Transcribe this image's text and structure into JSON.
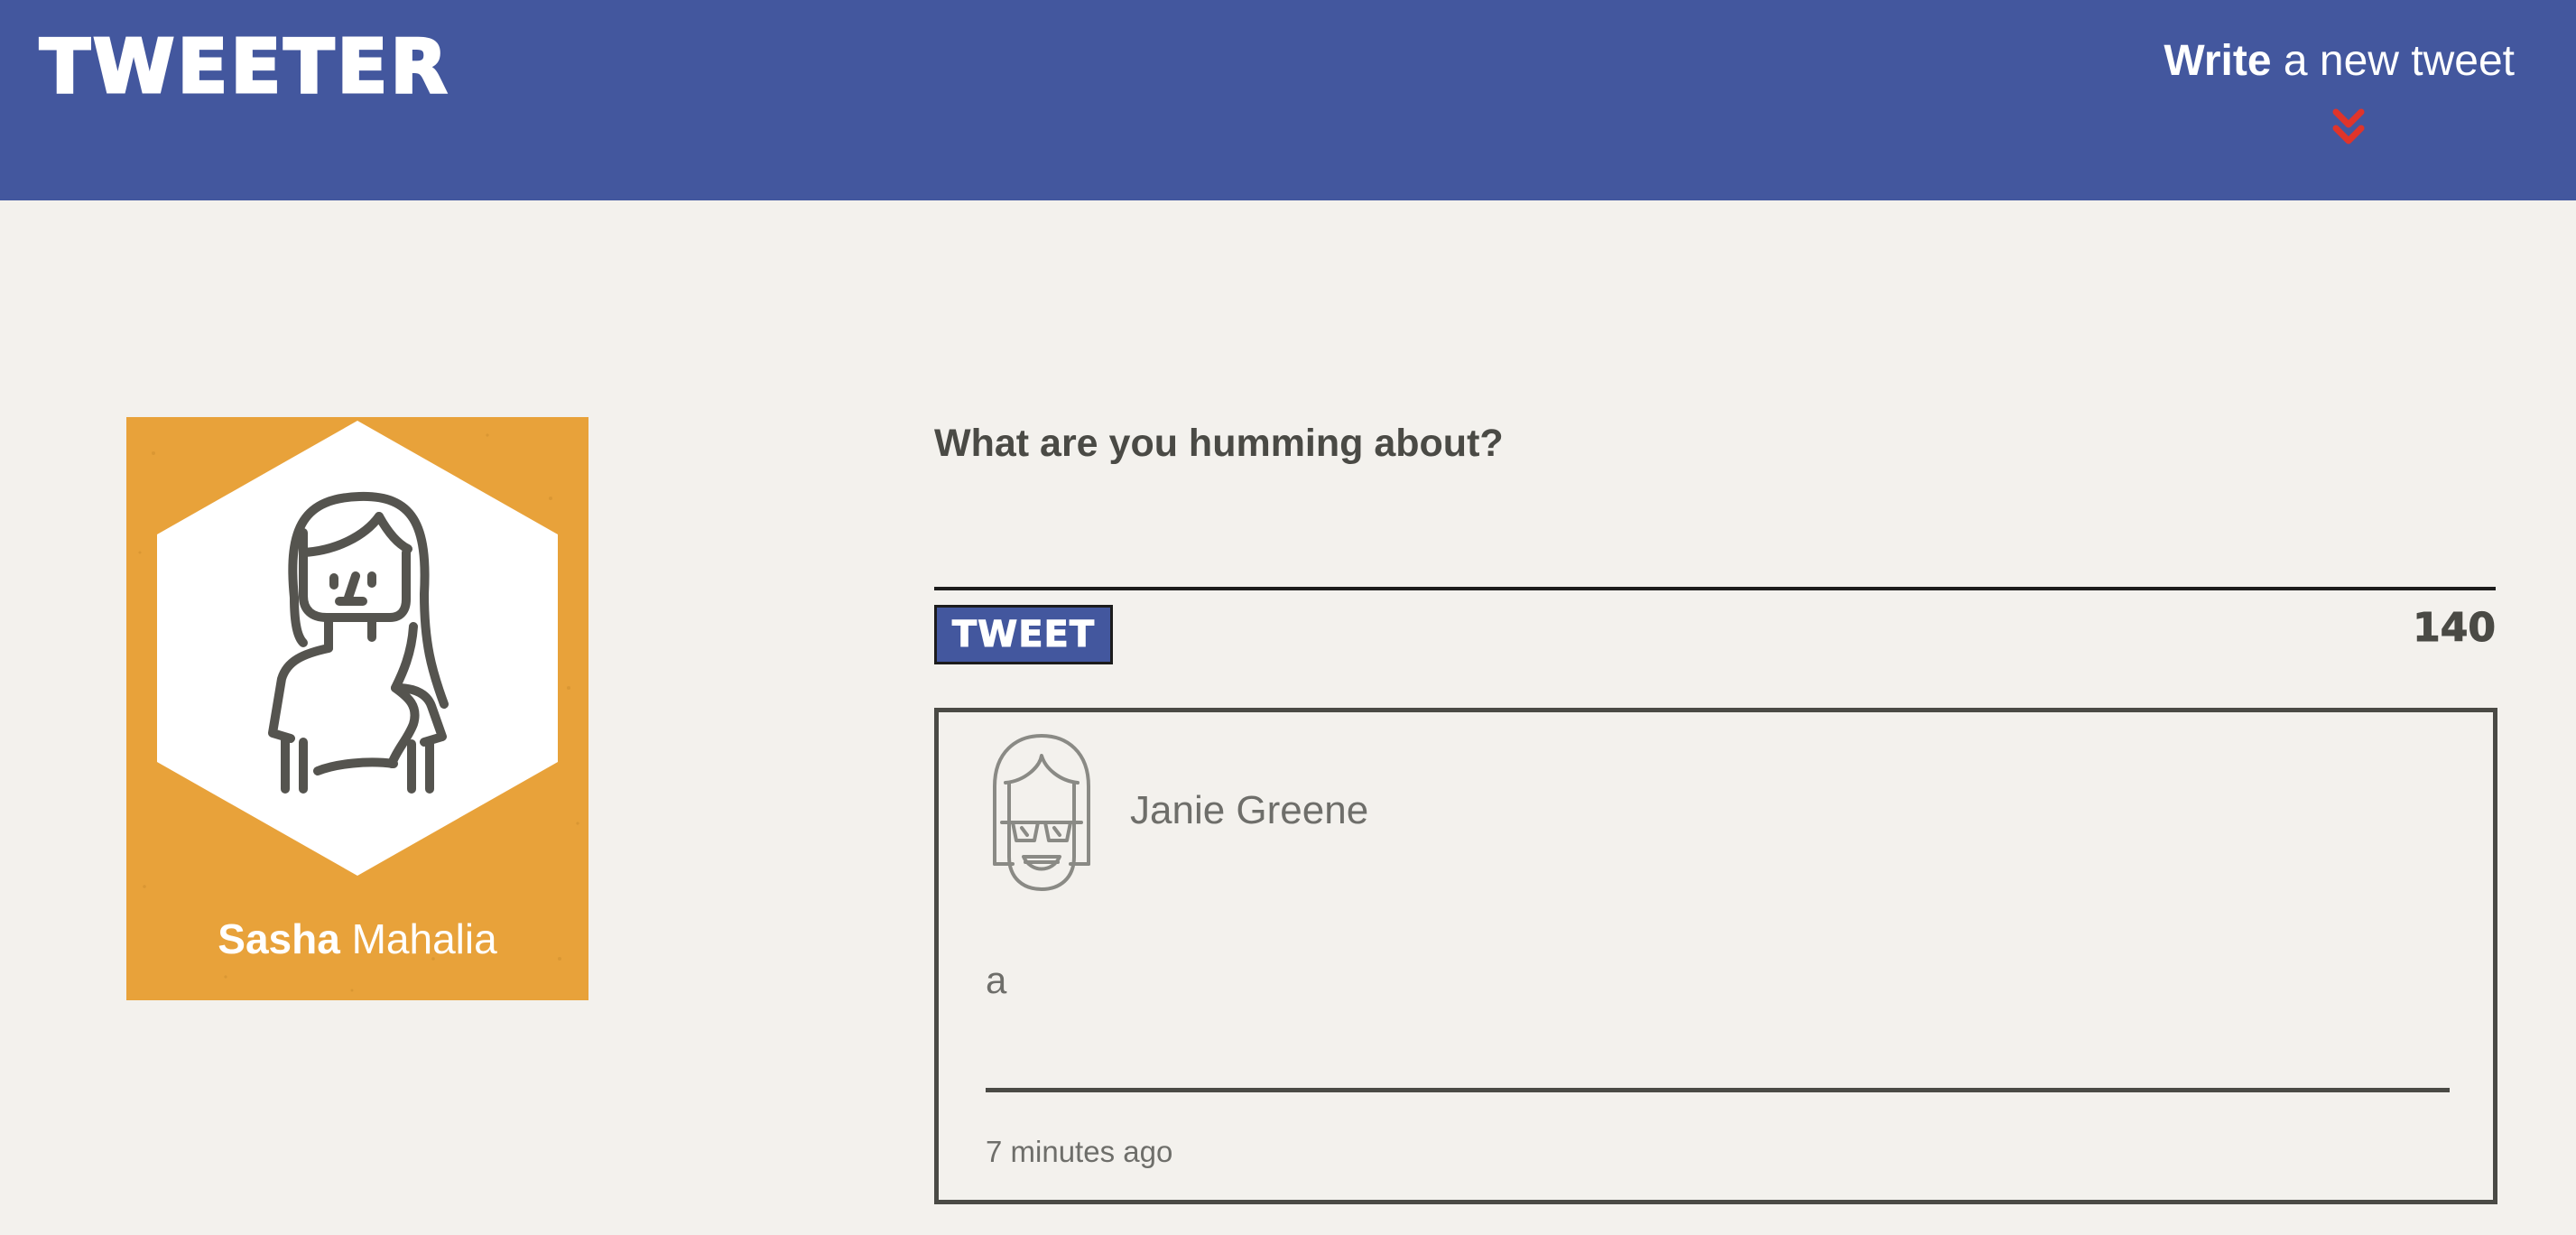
{
  "header": {
    "logo": "TWEETER",
    "compose_toggle": {
      "bold": "Write",
      "rest": " a new tweet",
      "icon": "double-chevron-down-icon"
    }
  },
  "profile": {
    "first_name": "Sasha",
    "last_name": " Mahalia",
    "avatar_icon": "woman-avatar-icon"
  },
  "compose": {
    "prompt": "What are you humming about?",
    "value": "",
    "button_label": "TWEET",
    "char_count": "140"
  },
  "tweets": [
    {
      "author": "Janie Greene",
      "avatar_icon": "woman-sunglasses-avatar-icon",
      "body": "a",
      "time": "7 minutes ago"
    }
  ],
  "colors": {
    "navbar": "#43579e",
    "background": "#f3f1ed",
    "profile_card": "#e8a23a",
    "accent_red": "#e0342a",
    "text_dark": "#4a4a45"
  }
}
